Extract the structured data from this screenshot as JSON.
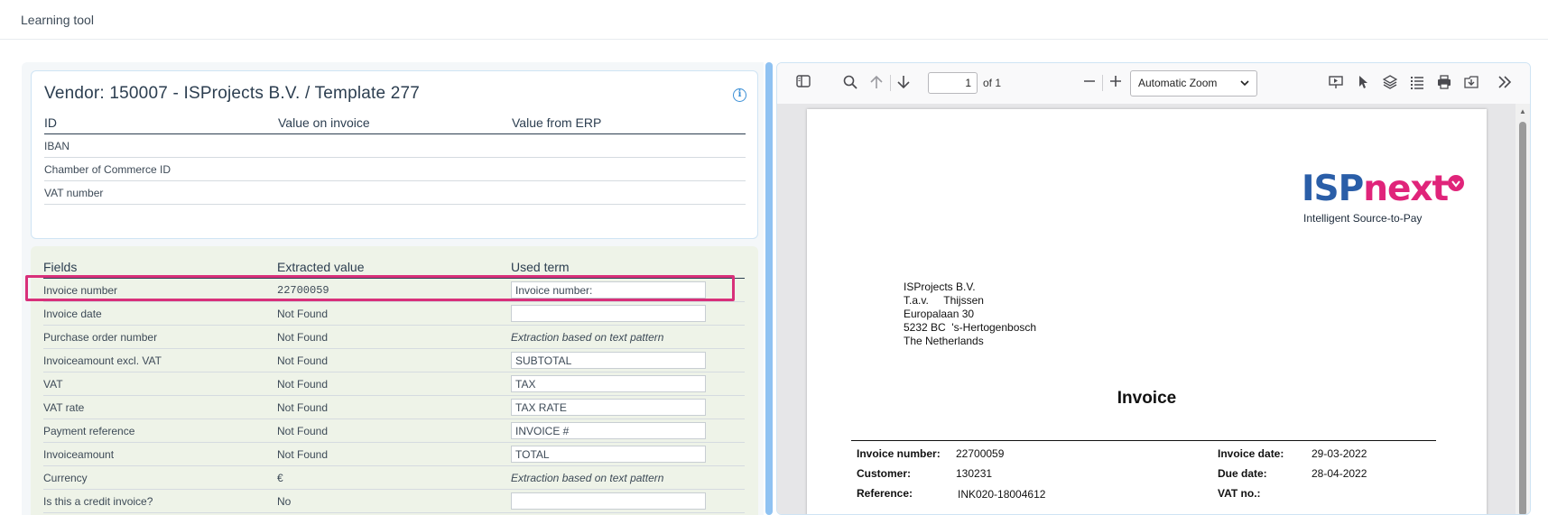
{
  "app": {
    "title": "Learning tool"
  },
  "vendor": {
    "title": "Vendor: 150007 - ISProjects B.V. / Template 277",
    "headers": [
      "ID",
      "Value on invoice",
      "Value from ERP"
    ],
    "rows": [
      {
        "id": "IBAN",
        "invoice": "",
        "erp": ""
      },
      {
        "id": "Chamber of Commerce ID",
        "invoice": "",
        "erp": ""
      },
      {
        "id": "VAT number",
        "invoice": "",
        "erp": ""
      }
    ]
  },
  "fields": {
    "headers": [
      "Fields",
      "Extracted value",
      "Used term"
    ],
    "rows": [
      {
        "field": "Invoice number",
        "value": "22700059",
        "term": "Invoice number:",
        "term_type": "input"
      },
      {
        "field": "Invoice date",
        "value": "Not Found",
        "term": "",
        "term_type": "input"
      },
      {
        "field": "Purchase order number",
        "value": "Not Found",
        "term": "Extraction based on text pattern",
        "term_type": "text"
      },
      {
        "field": "Invoiceamount excl. VAT",
        "value": "Not Found",
        "term": "SUBTOTAL",
        "term_type": "input"
      },
      {
        "field": "VAT",
        "value": "Not Found",
        "term": "TAX",
        "term_type": "input"
      },
      {
        "field": "VAT rate",
        "value": "Not Found",
        "term": "TAX RATE",
        "term_type": "input"
      },
      {
        "field": "Payment reference",
        "value": "Not Found",
        "term": "INVOICE #",
        "term_type": "input"
      },
      {
        "field": "Invoiceamount",
        "value": "Not Found",
        "term": "TOTAL",
        "term_type": "input"
      },
      {
        "field": "Currency",
        "value": "€",
        "term": "Extraction based on text pattern",
        "term_type": "text"
      },
      {
        "field": "Is this a credit invoice?",
        "value": "No",
        "term": "",
        "term_type": "input"
      }
    ]
  },
  "viewer": {
    "page_number": "1",
    "page_of": "of 1",
    "zoom": "Automatic Zoom"
  },
  "pdf": {
    "logo_part1": "ISP",
    "logo_part2": "next",
    "logo_tagline": "Intelligent Source-to-Pay",
    "address": [
      "ISProjects B.V.",
      "T.a.v.     Thijssen",
      "Europalaan 30",
      "5232 BC  's-Hertogenbosch",
      "The Netherlands"
    ],
    "title": "Invoice",
    "details": {
      "invoice_number_label": "Invoice number:",
      "invoice_number": "22700059",
      "customer_label": "Customer:",
      "customer": "130231",
      "reference_label": "Reference:",
      "reference": "INK020-18004612",
      "invoice_date_label": "Invoice date:",
      "invoice_date": "29-03-2022",
      "due_date_label": "Due date:",
      "due_date": "28-04-2022",
      "vat_no_label": "VAT no.:",
      "vat_no": ""
    }
  },
  "colors": {
    "accent": "#3b8fd6",
    "highlight": "#d8307a",
    "splitter": "#8fc2f2",
    "fields_bg": "#eef3e8"
  }
}
